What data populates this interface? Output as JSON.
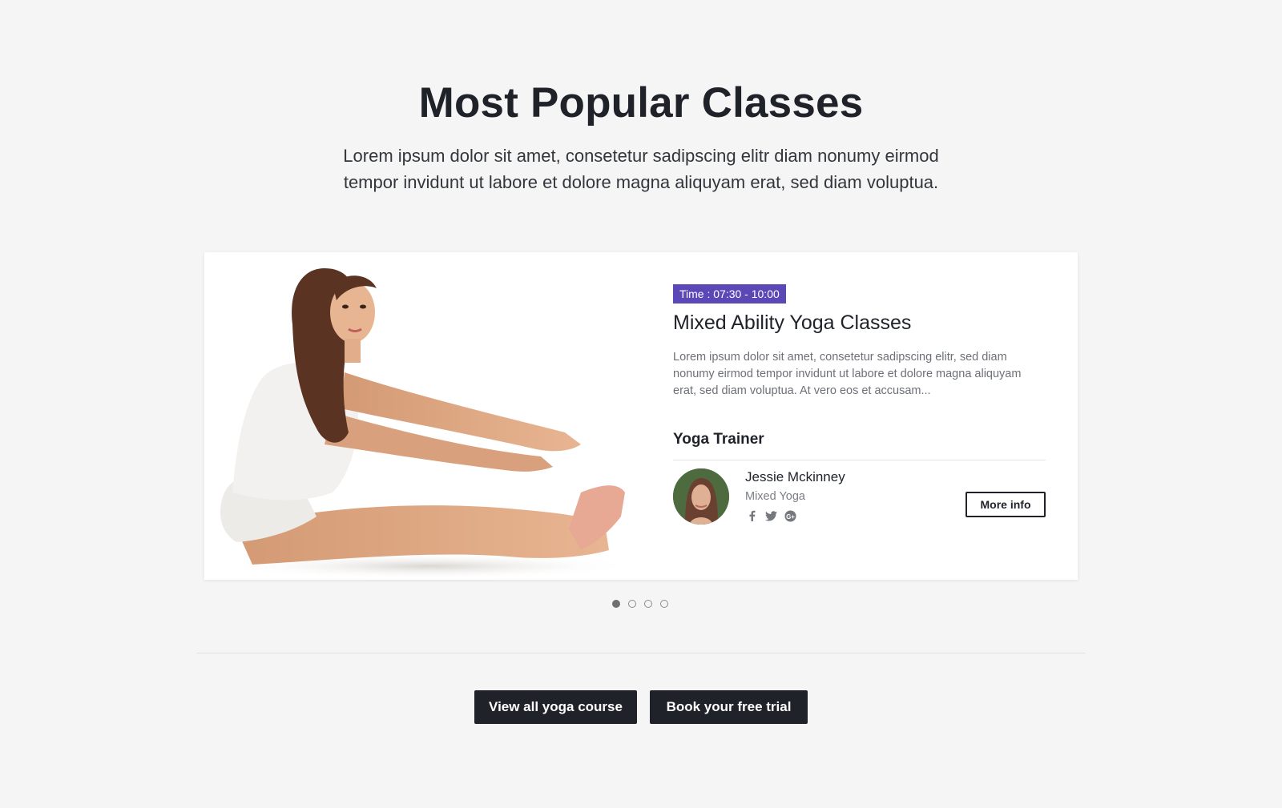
{
  "section": {
    "title": "Most Popular Classes",
    "subtitle_line1": "Lorem ipsum dolor sit amet, consetetur sadipscing elitr diam nonumy eirmod",
    "subtitle_line2": "tempor invidunt ut labore et dolore magna aliquyam erat, sed diam voluptua."
  },
  "class_card": {
    "time_badge": "Time : 07:30 - 10:00",
    "title": "Mixed Ability Yoga Classes",
    "description": "Lorem ipsum dolor sit amet, consetetur sadipscing elitr, sed diam nonumy eirmod tempor invidunt ut labore et dolore magna aliquyam erat, sed diam voluptua. At vero eos et accusam...",
    "trainer_heading": "Yoga Trainer",
    "trainer": {
      "name": "Jessie Mckinney",
      "role": "Mixed Yoga",
      "socials": [
        "facebook-icon",
        "twitter-icon",
        "google-plus-icon"
      ]
    },
    "more_info_label": "More info"
  },
  "carousel": {
    "slide_count": 4,
    "active_index": 0
  },
  "actions": {
    "view_all_label": "View all yoga course",
    "free_trial_label": "Book your free trial"
  },
  "colors": {
    "background": "#f4f5f4",
    "badge": "#5b47b5",
    "dark_button": "#1f2229"
  }
}
